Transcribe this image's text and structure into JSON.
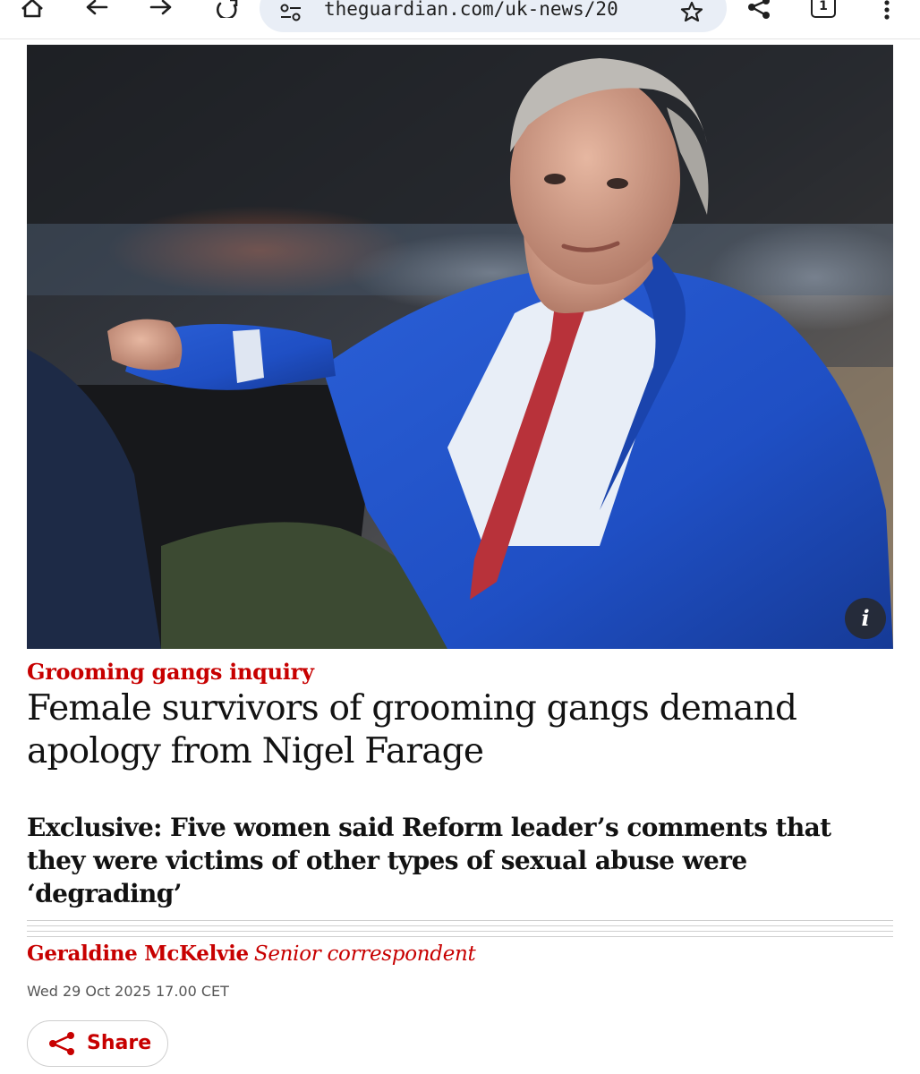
{
  "browser": {
    "url": "theguardian.com/uk-news/20",
    "tab_count": "1",
    "icons": [
      "home-icon",
      "back-arrow-icon",
      "forward-arrow-icon",
      "reload-icon",
      "site-settings-icon",
      "bookmark-star-icon",
      "share-icon",
      "tab-switcher-icon",
      "overflow-menu-icon"
    ]
  },
  "article": {
    "image_info_label": "i",
    "kicker": "Grooming gangs inquiry",
    "headline": "Female survivors of grooming gangs demand apology from Nigel Farage",
    "standfirst": "Exclusive: Five women said Reform leader’s comments that they were victims of other types of sexual abuse were ‘degrading’",
    "author": "Geraldine McKelvie",
    "author_role": "Senior correspondent",
    "dateline": "Wed 29 Oct 2025 17.00 CET",
    "share_label": "Share"
  },
  "colors": {
    "accent_red": "#c70000",
    "text": "#121212",
    "url_bar": "#e9eef6"
  }
}
